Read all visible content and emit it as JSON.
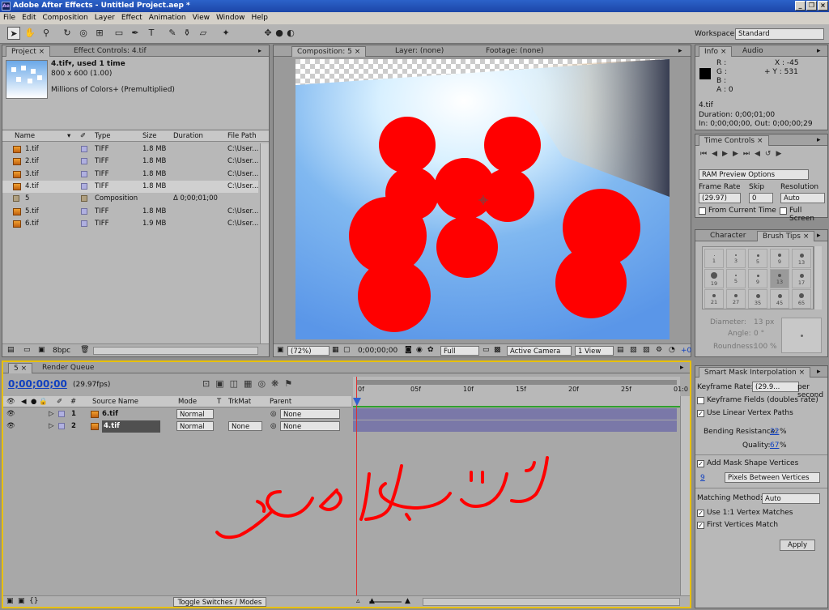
{
  "window": {
    "title": "Adobe After Effects - Untitled Project.aep *",
    "app_icon": "Ae",
    "min": "_",
    "restore": "❐",
    "close": "×"
  },
  "menu": [
    "File",
    "Edit",
    "Composition",
    "Layer",
    "Effect",
    "Animation",
    "View",
    "Window",
    "Help"
  ],
  "workspace": {
    "label": "Workspace:",
    "value": "Standard"
  },
  "project": {
    "tab_project": "Project",
    "tab_effects": "Effect Controls: 4.tif",
    "thumb_name": "4.tif▾, used 1 time",
    "thumb_size": "800 x 600 (1.00)",
    "thumb_colors": "Millions of Colors+ (Premultiplied)",
    "columns": [
      "Name",
      "Type",
      "Size",
      "Duration",
      "File Path"
    ],
    "rows": [
      {
        "name": "1.tif",
        "type": "TIFF",
        "size": "1.8 MB",
        "duration": "",
        "path": "C:\\User..."
      },
      {
        "name": "2.tif",
        "type": "TIFF",
        "size": "1.8 MB",
        "duration": "",
        "path": "C:\\User..."
      },
      {
        "name": "3.tif",
        "type": "TIFF",
        "size": "1.8 MB",
        "duration": "",
        "path": "C:\\User..."
      },
      {
        "name": "4.tif",
        "type": "TIFF",
        "size": "1.8 MB",
        "duration": "",
        "path": "C:\\User..."
      },
      {
        "name": "5",
        "type": "Composition",
        "size": "",
        "duration": "Δ 0;00;01;00",
        "path": ""
      },
      {
        "name": "5.tif",
        "type": "TIFF",
        "size": "1.8 MB",
        "duration": "",
        "path": "C:\\User..."
      },
      {
        "name": "6.tif",
        "type": "TIFF",
        "size": "1.9 MB",
        "duration": "",
        "path": "C:\\User..."
      }
    ],
    "bpc": "8bpc"
  },
  "viewer": {
    "tab_comp": "Composition: 5",
    "tab_layer": "Layer: (none)",
    "tab_footage": "Footage: (none)",
    "zoom": "(72%)",
    "timecode": "0;00;00;00",
    "resolution": "Full",
    "camera": "Active Camera",
    "views": "1 View",
    "offset": "+0"
  },
  "info": {
    "tab_info": "Info",
    "tab_audio": "Audio",
    "r": "R :",
    "g": "G :",
    "b": "B :",
    "a": "A : 0",
    "x": "X : -45",
    "y": "+ Y : 531",
    "file": "4.tif",
    "duration": "Duration: 0;00;01;00",
    "inout": "In: 0;00;00;00, Out: 0;00;00;29"
  },
  "time_controls": {
    "tab": "Time Controls",
    "ram_preview": "RAM Preview Options",
    "frame_rate_label": "Frame Rate",
    "skip_label": "Skip",
    "resolution_label": "Resolution",
    "frame_rate": "(29.97)",
    "skip": "0",
    "resolution": "Auto",
    "from_current": "From Current Time",
    "full_screen": "Full Screen"
  },
  "brush": {
    "tab_char": "Character",
    "tab_brush": "Brush Tips",
    "sizes": [
      "1",
      "3",
      "5",
      "9",
      "13",
      "19",
      "5",
      "9",
      "13",
      "17",
      "21",
      "27",
      "35",
      "45",
      "65"
    ],
    "diameter_label": "Diameter:",
    "diameter": "13 px",
    "angle_label": "Angle:",
    "angle": "0 °",
    "roundness_label": "Roundness:",
    "roundness": "100 %"
  },
  "timeline": {
    "tab_comp": "5",
    "tab_render": "Render Queue",
    "timecode": "0;00;00;00",
    "fps": "(29.97fps)",
    "columns": {
      "num": "#",
      "source": "Source Name",
      "mode": "Mode",
      "t": "T",
      "trkmat": "TrkMat",
      "parent": "Parent"
    },
    "ruler": [
      "0f",
      "05f",
      "10f",
      "15f",
      "20f",
      "25f",
      "01:0"
    ],
    "layers": [
      {
        "num": "1",
        "name": "6.tif",
        "mode": "Normal",
        "trkmat": "",
        "parent": "None"
      },
      {
        "num": "2",
        "name": "4.tif",
        "mode": "Normal",
        "trkmat": "None",
        "parent": "None"
      }
    ],
    "toggle": "Toggle Switches / Modes",
    "annotation": "ترتيب الصور"
  },
  "smart_mask": {
    "tab": "Smart Mask Interpolation",
    "keyframe_rate_label": "Keyframe Rate:",
    "keyframe_rate": "(29.9...",
    "per_second": "per second",
    "keyframe_fields": "Keyframe Fields (doubles rate)",
    "linear_paths": "Use Linear Vertex Paths",
    "bending_label": "Bending Resistance:",
    "bending": "32",
    "quality_label": "Quality:",
    "quality": "67",
    "pct": "%",
    "add_vertices": "Add Mask Shape Vertices",
    "pixels_value": "9",
    "pixels_between": "Pixels Between Vertices",
    "matching_label": "Matching Method:",
    "matching": "Auto",
    "one_to_one": "Use 1:1 Vertex Matches",
    "first_vertices": "First Vertices Match",
    "apply": "Apply"
  }
}
